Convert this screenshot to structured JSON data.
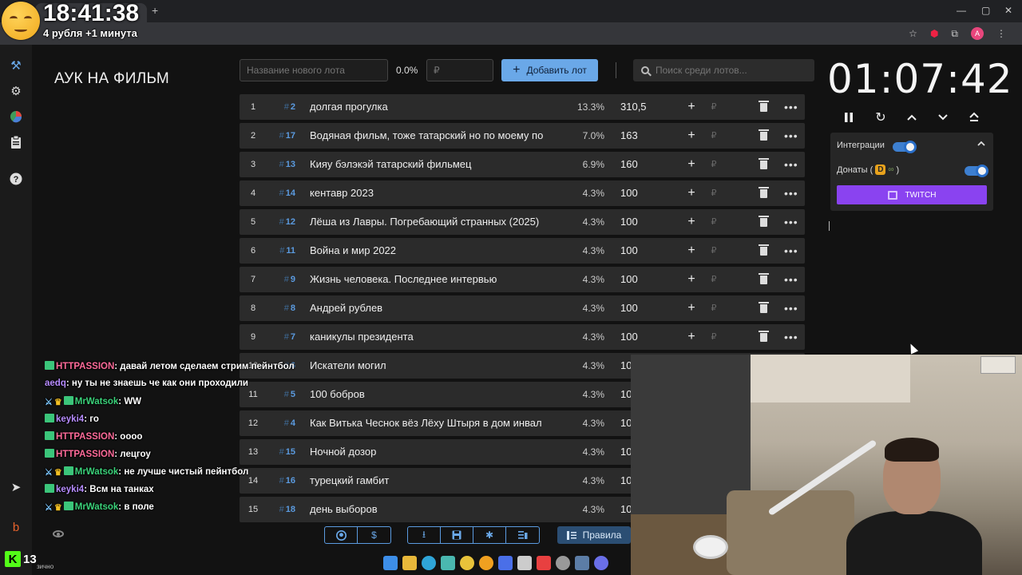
{
  "overlay": {
    "clock": "18:41:38",
    "rub_line": "4 рубля +1 минута"
  },
  "app": {
    "title": "АУК НА ФИЛЬМ"
  },
  "sidebar": {
    "items": [
      {
        "icon": "gavel-icon"
      },
      {
        "icon": "gear-icon"
      },
      {
        "icon": "pie-chart-icon"
      },
      {
        "icon": "clipboard-icon"
      },
      {
        "icon": "help-icon"
      },
      {
        "icon": "telegram-icon"
      },
      {
        "icon": "boosty-icon"
      }
    ]
  },
  "form": {
    "lot_name_placeholder": "Название нового лота",
    "percent": "0.0%",
    "amount_placeholder": "₽",
    "add_button": "Добавить лот",
    "search_placeholder": "Поиск среди лотов..."
  },
  "lots": [
    {
      "idx": "1",
      "id": "2",
      "name": "долгая прогулка",
      "pct": "13.3%",
      "amount": "310,5"
    },
    {
      "idx": "2",
      "id": "17",
      "name": "Водяная фильм, тоже татарский но по моему по",
      "pct": "7.0%",
      "amount": "163"
    },
    {
      "idx": "3",
      "id": "13",
      "name": "Кияу бэлэкэй татарский фильмец",
      "pct": "6.9%",
      "amount": "160"
    },
    {
      "idx": "4",
      "id": "14",
      "name": "кентавр 2023",
      "pct": "4.3%",
      "amount": "100"
    },
    {
      "idx": "5",
      "id": "12",
      "name": "Лёша из Лавры. Погребающий странных (2025)",
      "pct": "4.3%",
      "amount": "100"
    },
    {
      "idx": "6",
      "id": "11",
      "name": "Война и мир 2022",
      "pct": "4.3%",
      "amount": "100"
    },
    {
      "idx": "7",
      "id": "9",
      "name": "Жизнь человека. Последнее интервью",
      "pct": "4.3%",
      "amount": "100"
    },
    {
      "idx": "8",
      "id": "8",
      "name": "Андрей рублев",
      "pct": "4.3%",
      "amount": "100"
    },
    {
      "idx": "9",
      "id": "7",
      "name": "каникулы президента",
      "pct": "4.3%",
      "amount": "100"
    },
    {
      "idx": "10",
      "id": "6",
      "name": "Искатели могил",
      "pct": "4.3%",
      "amount": "10"
    },
    {
      "idx": "11",
      "id": "5",
      "name": "100 бобров",
      "pct": "4.3%",
      "amount": "10"
    },
    {
      "idx": "12",
      "id": "4",
      "name": "Как Витька Чеснок вёз Лёху Штыря в дом инвал",
      "pct": "4.3%",
      "amount": "10"
    },
    {
      "idx": "13",
      "id": "15",
      "name": "Ночной дозор",
      "pct": "4.3%",
      "amount": "10"
    },
    {
      "idx": "14",
      "id": "16",
      "name": "турецкий гамбит",
      "pct": "4.3%",
      "amount": "10"
    },
    {
      "idx": "15",
      "id": "18",
      "name": "день выборов",
      "pct": "4.3%",
      "amount": "10"
    }
  ],
  "lot_actions": {
    "plus": "+",
    "currency": "₽",
    "more": "•••"
  },
  "toolbar": {
    "rules_label": "Правила"
  },
  "timer": {
    "value": "01:07:42"
  },
  "integrations": {
    "label": "Интеграции",
    "donations_label_prefix": "Донаты (",
    "donations_label_suffix": ")",
    "twitch_button": "TWITCH",
    "integrations_enabled": true,
    "donations_enabled": true
  },
  "chat": [
    {
      "badges": [
        "green"
      ],
      "user": "HTTPASSION",
      "color": "#ff6b9a",
      "text": "давай летом сделаем стрим пейнтбол"
    },
    {
      "badges": [],
      "user": "aedq",
      "color": "#b78cff",
      "text": "ну ты не знаешь че как они проходили"
    },
    {
      "badges": [
        "sword",
        "crown",
        "green"
      ],
      "user": "MrWatsok",
      "color": "#3bd27a",
      "text": "WW"
    },
    {
      "badges": [
        "green"
      ],
      "user": "keyki4",
      "color": "#b78cff",
      "text": "го"
    },
    {
      "badges": [
        "green"
      ],
      "user": "HTTPASSION",
      "color": "#ff6b9a",
      "text": "оооо"
    },
    {
      "badges": [
        "green"
      ],
      "user": "HTTPASSION",
      "color": "#ff6b9a",
      "text": "лецгоу"
    },
    {
      "badges": [
        "sword",
        "crown",
        "green"
      ],
      "user": "MrWatsok",
      "color": "#3bd27a",
      "text": "не лучше чистый пейнтбол"
    },
    {
      "badges": [
        "green"
      ],
      "user": "keyki4",
      "color": "#b78cff",
      "text": "Всм на танках"
    },
    {
      "badges": [
        "sword",
        "crown",
        "green"
      ],
      "user": "MrWatsok",
      "color": "#3bd27a",
      "text": "в поле"
    }
  ],
  "kick": {
    "logo": "K",
    "viewers": "13",
    "small_text": "зично"
  },
  "colors": {
    "accent": "#6aa8e8",
    "lot_id": "#5b9be0",
    "twitch": "#8a43f0",
    "kick": "#53fc18"
  }
}
